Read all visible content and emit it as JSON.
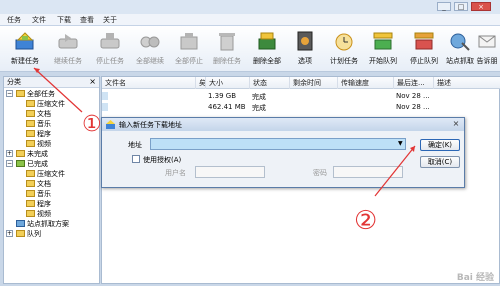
{
  "window": {
    "minimize": "_",
    "maximize": "□",
    "close": "×"
  },
  "menu": [
    "任务",
    "文件",
    "下载",
    "查看",
    "关于"
  ],
  "toolbar": [
    {
      "label": "新建任务",
      "icon": "new-task-icon",
      "enabled": true
    },
    {
      "label": "继续任务",
      "icon": "resume-task-icon",
      "enabled": false
    },
    {
      "label": "停止任务",
      "icon": "stop-task-icon",
      "enabled": false
    },
    {
      "label": "全部继续",
      "icon": "resume-all-icon",
      "enabled": false
    },
    {
      "label": "全部停止",
      "icon": "stop-all-icon",
      "enabled": false
    },
    {
      "label": "删除任务",
      "icon": "delete-task-icon",
      "enabled": false
    },
    {
      "label": "删除全部",
      "icon": "delete-all-icon",
      "enabled": true
    },
    {
      "label": "选项",
      "icon": "options-icon",
      "enabled": true
    },
    {
      "label": "计划任务",
      "icon": "schedule-icon",
      "enabled": true
    },
    {
      "label": "开始队列",
      "icon": "start-queue-icon",
      "enabled": true
    },
    {
      "label": "停止队列",
      "icon": "stop-queue-icon",
      "enabled": true
    },
    {
      "label": "站点抓取",
      "icon": "site-grab-icon",
      "enabled": true
    },
    {
      "label": "告诉朋",
      "icon": "tell-friend-icon",
      "enabled": true
    }
  ],
  "sidebar": {
    "title": "分类",
    "close": "×",
    "tree": [
      {
        "label": "全部任务",
        "toggle": "−"
      },
      {
        "label": "压缩文件"
      },
      {
        "label": "文档"
      },
      {
        "label": "音乐"
      },
      {
        "label": "程序"
      },
      {
        "label": "视频"
      },
      {
        "label": "未完成",
        "toggle": "+"
      },
      {
        "label": "已完成",
        "toggle": "−"
      },
      {
        "label": "压缩文件"
      },
      {
        "label": "文档"
      },
      {
        "label": "音乐"
      },
      {
        "label": "程序"
      },
      {
        "label": "视频"
      },
      {
        "label": "站点抓取方案"
      },
      {
        "label": "队列",
        "toggle": "+"
      }
    ]
  },
  "list": {
    "columns": [
      "文件名",
      "矣",
      "大小",
      "状态",
      "剩余时间",
      "传输速度",
      "最后连...",
      "描述"
    ],
    "rows": [
      {
        "size": "1.39 GB",
        "status": "完成",
        "last": "Nov 28 ..."
      },
      {
        "size": "462.41 MB",
        "status": "完成",
        "last": "Nov 28 ..."
      }
    ]
  },
  "dialog": {
    "title": "输入新任务下载地址",
    "close": "×",
    "url_label": "地址",
    "auth_label": "使用授权(A)",
    "user_label": "用户名",
    "pass_label": "密码",
    "ok": "确定(K)",
    "cancel": "取消(C)"
  },
  "annotations": {
    "one": "①",
    "two": "②"
  },
  "watermark": "Bai 经验"
}
